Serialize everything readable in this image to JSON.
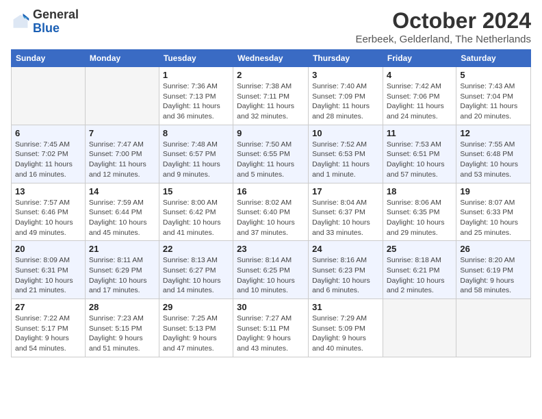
{
  "logo": {
    "general": "General",
    "blue": "Blue"
  },
  "header": {
    "month": "October 2024",
    "location": "Eerbeek, Gelderland, The Netherlands"
  },
  "weekdays": [
    "Sunday",
    "Monday",
    "Tuesday",
    "Wednesday",
    "Thursday",
    "Friday",
    "Saturday"
  ],
  "weeks": [
    [
      {
        "day": "",
        "info": ""
      },
      {
        "day": "",
        "info": ""
      },
      {
        "day": "1",
        "info": "Sunrise: 7:36 AM\nSunset: 7:13 PM\nDaylight: 11 hours and 36 minutes."
      },
      {
        "day": "2",
        "info": "Sunrise: 7:38 AM\nSunset: 7:11 PM\nDaylight: 11 hours and 32 minutes."
      },
      {
        "day": "3",
        "info": "Sunrise: 7:40 AM\nSunset: 7:09 PM\nDaylight: 11 hours and 28 minutes."
      },
      {
        "day": "4",
        "info": "Sunrise: 7:42 AM\nSunset: 7:06 PM\nDaylight: 11 hours and 24 minutes."
      },
      {
        "day": "5",
        "info": "Sunrise: 7:43 AM\nSunset: 7:04 PM\nDaylight: 11 hours and 20 minutes."
      }
    ],
    [
      {
        "day": "6",
        "info": "Sunrise: 7:45 AM\nSunset: 7:02 PM\nDaylight: 11 hours and 16 minutes."
      },
      {
        "day": "7",
        "info": "Sunrise: 7:47 AM\nSunset: 7:00 PM\nDaylight: 11 hours and 12 minutes."
      },
      {
        "day": "8",
        "info": "Sunrise: 7:48 AM\nSunset: 6:57 PM\nDaylight: 11 hours and 9 minutes."
      },
      {
        "day": "9",
        "info": "Sunrise: 7:50 AM\nSunset: 6:55 PM\nDaylight: 11 hours and 5 minutes."
      },
      {
        "day": "10",
        "info": "Sunrise: 7:52 AM\nSunset: 6:53 PM\nDaylight: 11 hours and 1 minute."
      },
      {
        "day": "11",
        "info": "Sunrise: 7:53 AM\nSunset: 6:51 PM\nDaylight: 10 hours and 57 minutes."
      },
      {
        "day": "12",
        "info": "Sunrise: 7:55 AM\nSunset: 6:48 PM\nDaylight: 10 hours and 53 minutes."
      }
    ],
    [
      {
        "day": "13",
        "info": "Sunrise: 7:57 AM\nSunset: 6:46 PM\nDaylight: 10 hours and 49 minutes."
      },
      {
        "day": "14",
        "info": "Sunrise: 7:59 AM\nSunset: 6:44 PM\nDaylight: 10 hours and 45 minutes."
      },
      {
        "day": "15",
        "info": "Sunrise: 8:00 AM\nSunset: 6:42 PM\nDaylight: 10 hours and 41 minutes."
      },
      {
        "day": "16",
        "info": "Sunrise: 8:02 AM\nSunset: 6:40 PM\nDaylight: 10 hours and 37 minutes."
      },
      {
        "day": "17",
        "info": "Sunrise: 8:04 AM\nSunset: 6:37 PM\nDaylight: 10 hours and 33 minutes."
      },
      {
        "day": "18",
        "info": "Sunrise: 8:06 AM\nSunset: 6:35 PM\nDaylight: 10 hours and 29 minutes."
      },
      {
        "day": "19",
        "info": "Sunrise: 8:07 AM\nSunset: 6:33 PM\nDaylight: 10 hours and 25 minutes."
      }
    ],
    [
      {
        "day": "20",
        "info": "Sunrise: 8:09 AM\nSunset: 6:31 PM\nDaylight: 10 hours and 21 minutes."
      },
      {
        "day": "21",
        "info": "Sunrise: 8:11 AM\nSunset: 6:29 PM\nDaylight: 10 hours and 17 minutes."
      },
      {
        "day": "22",
        "info": "Sunrise: 8:13 AM\nSunset: 6:27 PM\nDaylight: 10 hours and 14 minutes."
      },
      {
        "day": "23",
        "info": "Sunrise: 8:14 AM\nSunset: 6:25 PM\nDaylight: 10 hours and 10 minutes."
      },
      {
        "day": "24",
        "info": "Sunrise: 8:16 AM\nSunset: 6:23 PM\nDaylight: 10 hours and 6 minutes."
      },
      {
        "day": "25",
        "info": "Sunrise: 8:18 AM\nSunset: 6:21 PM\nDaylight: 10 hours and 2 minutes."
      },
      {
        "day": "26",
        "info": "Sunrise: 8:20 AM\nSunset: 6:19 PM\nDaylight: 9 hours and 58 minutes."
      }
    ],
    [
      {
        "day": "27",
        "info": "Sunrise: 7:22 AM\nSunset: 5:17 PM\nDaylight: 9 hours and 54 minutes."
      },
      {
        "day": "28",
        "info": "Sunrise: 7:23 AM\nSunset: 5:15 PM\nDaylight: 9 hours and 51 minutes."
      },
      {
        "day": "29",
        "info": "Sunrise: 7:25 AM\nSunset: 5:13 PM\nDaylight: 9 hours and 47 minutes."
      },
      {
        "day": "30",
        "info": "Sunrise: 7:27 AM\nSunset: 5:11 PM\nDaylight: 9 hours and 43 minutes."
      },
      {
        "day": "31",
        "info": "Sunrise: 7:29 AM\nSunset: 5:09 PM\nDaylight: 9 hours and 40 minutes."
      },
      {
        "day": "",
        "info": ""
      },
      {
        "day": "",
        "info": ""
      }
    ]
  ]
}
